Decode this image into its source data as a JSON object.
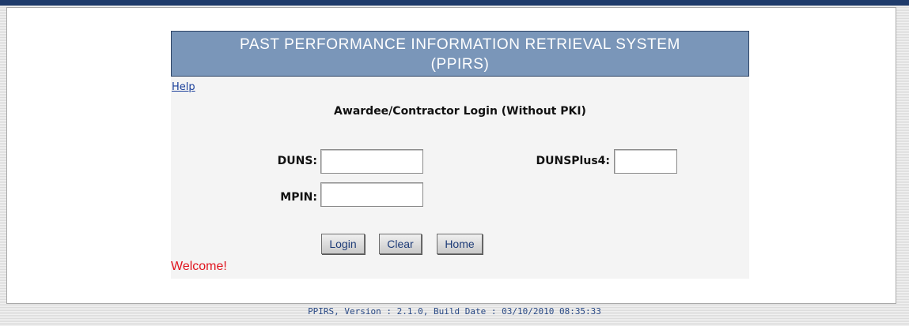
{
  "header": {
    "title_line1": "PAST PERFORMANCE INFORMATION RETRIEVAL SYSTEM",
    "title_line2": "(PPIRS)"
  },
  "help_link": "Help",
  "form": {
    "subtitle": "Awardee/Contractor Login (Without PKI)",
    "duns_label": "DUNS:",
    "duns_value": "",
    "dunsplus4_label": "DUNSPlus4:",
    "dunsplus4_value": "",
    "mpin_label": "MPIN:",
    "mpin_value": ""
  },
  "buttons": {
    "login": "Login",
    "clear": "Clear",
    "home": "Home"
  },
  "status_message": "Welcome!",
  "footer": "PPIRS, Version : 2.1.0, Build Date : 03/10/2010 08:35:33",
  "colors": {
    "title_bar": "#7a96b9",
    "link": "#1a3f9a",
    "welcome": "#e0141e",
    "footer_text": "#2a4a86"
  }
}
